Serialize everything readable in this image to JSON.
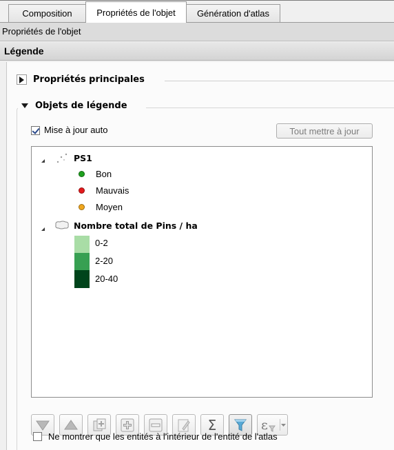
{
  "tabs": [
    {
      "label": "Composition",
      "active": false
    },
    {
      "label": "Propriétés de l'objet",
      "active": true
    },
    {
      "label": "Génération d'atlas",
      "active": false
    }
  ],
  "panel": {
    "title": "Propriétés de l'objet"
  },
  "section": {
    "title": "Légende"
  },
  "groups": {
    "proprietes_principales": {
      "label": "Propriétés principales",
      "expanded": false
    },
    "objets_de_legende": {
      "label": "Objets de légende",
      "expanded": true
    }
  },
  "auto_update": {
    "label": "Mise à jour auto",
    "checked": true
  },
  "update_all_button": {
    "label": "Tout mettre à jour",
    "enabled": false
  },
  "legend_tree": {
    "layers": [
      {
        "name": "PS1",
        "icon": "point-layer-icon",
        "items": [
          {
            "label": "Bon",
            "color": "#1fa11f"
          },
          {
            "label": "Mauvais",
            "color": "#e31a1c"
          },
          {
            "label": "Moyen",
            "color": "#f0a61d"
          }
        ]
      },
      {
        "name": "Nombre total de Pins / ha",
        "icon": "polygon-layer-icon",
        "items": [
          {
            "label": "0-2",
            "color": "#a9dda6"
          },
          {
            "label": "2-20",
            "color": "#37a052"
          },
          {
            "label": "20-40",
            "color": "#00441b"
          }
        ]
      }
    ]
  },
  "toolbar": {
    "buttons": [
      {
        "name": "move-down-icon"
      },
      {
        "name": "move-up-icon"
      },
      {
        "name": "add-group-icon"
      },
      {
        "name": "add-item-icon"
      },
      {
        "name": "remove-item-icon"
      },
      {
        "name": "edit-item-icon"
      },
      {
        "name": "count-features-icon",
        "glyph": "Σ"
      },
      {
        "name": "filter-legend-icon",
        "active": true
      },
      {
        "name": "expression-filter-icon",
        "glyph": "ε"
      }
    ]
  },
  "atlas_only": {
    "label": "Ne montrer que les entités à l'intérieur de l'entité de l'atlas",
    "checked": false
  }
}
